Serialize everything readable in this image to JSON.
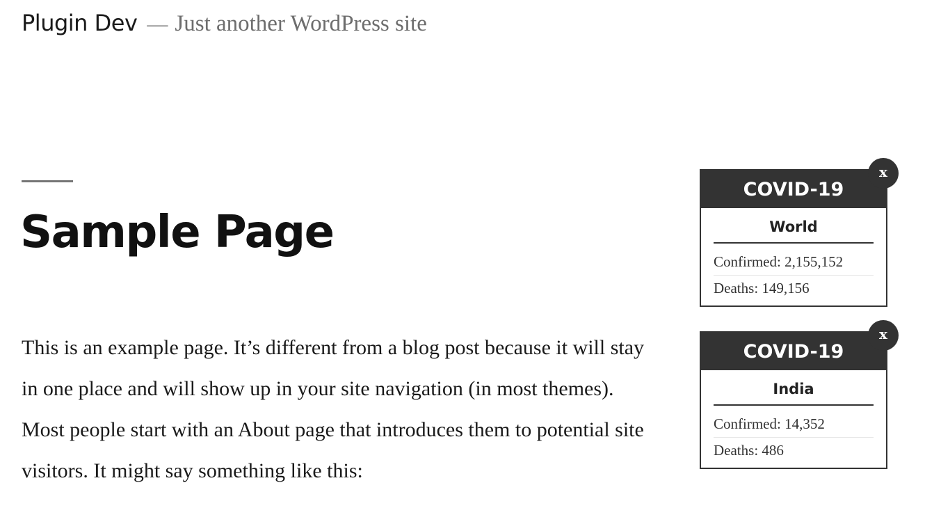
{
  "site": {
    "title": "Plugin Dev",
    "separator": "—",
    "description": "Just another WordPress site"
  },
  "page": {
    "title": "Sample Page",
    "body": "This is an example page. It’s different from a blog post because it will stay in one place and will show up in your site navigation (in most themes). Most people start with an About page that introduces them to potential site visitors. It might say something like this:"
  },
  "widgets": [
    {
      "header": "COVID-19",
      "region": "World",
      "confirmed": "Confirmed: 2,155,152",
      "deaths": "Deaths: 149,156",
      "close_label": "x"
    },
    {
      "header": "COVID-19",
      "region": "India",
      "confirmed": "Confirmed: 14,352",
      "deaths": "Deaths: 486",
      "close_label": "x"
    }
  ],
  "colors": {
    "widget_dark": "#333333",
    "text": "#1a1a1a",
    "muted": "#767676"
  }
}
